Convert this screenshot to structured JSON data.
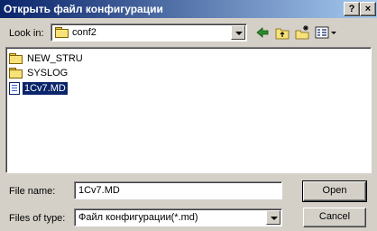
{
  "window": {
    "title": "Открыть файл конфигурации",
    "help_label": "?",
    "close_label": "×"
  },
  "lookin": {
    "label": "Look in:",
    "value": "conf2"
  },
  "files": [
    {
      "name": "NEW_STRU",
      "type": "folder",
      "selected": false
    },
    {
      "name": "SYSLOG",
      "type": "folder",
      "selected": false
    },
    {
      "name": "1Cv7.MD",
      "type": "file",
      "selected": true
    }
  ],
  "filename": {
    "label": "File name:",
    "value": "1Cv7.MD"
  },
  "filetype": {
    "label": "Files of type:",
    "value": "Файл конфигурации(*.md)"
  },
  "buttons": {
    "open": "Open",
    "cancel": "Cancel"
  }
}
